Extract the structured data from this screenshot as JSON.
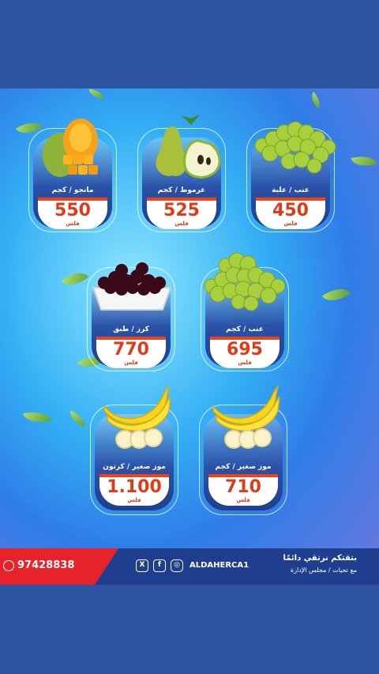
{
  "products": [
    {
      "id": "mango",
      "label": "مانجو / كجم",
      "price": "550",
      "unit": "فلس",
      "fruit_icon": "mango-icon"
    },
    {
      "id": "pear",
      "label": "عرموط / كجم",
      "price": "525",
      "unit": "فلس",
      "fruit_icon": "pear-icon"
    },
    {
      "id": "grapes-box",
      "label": "عنب / علبة",
      "price": "450",
      "unit": "فلس",
      "fruit_icon": "grapes-icon"
    },
    {
      "id": "cherry",
      "label": "كرز / طبق",
      "price": "770",
      "unit": "فلس",
      "fruit_icon": "cherry-tray-icon"
    },
    {
      "id": "grapes-kg",
      "label": "عنب / كجم",
      "price": "695",
      "unit": "فلس",
      "fruit_icon": "grapes-icon"
    },
    {
      "id": "banana-carton",
      "label": "موز صغير / كرتون",
      "price": "1.100",
      "unit": "فلس",
      "fruit_icon": "banana-icon"
    },
    {
      "id": "banana-kg",
      "label": "موز صغير / كجم",
      "price": "710",
      "unit": "فلس",
      "fruit_icon": "banana-icon"
    }
  ],
  "footer": {
    "phone": "97428838",
    "handle": "ALDAHERCA1",
    "slogan": "بثقتكم نرتقي دائمًا",
    "sub_slogan": "مع تحيات / مجلس الإدارة",
    "social_icons": [
      "x-icon",
      "facebook-icon",
      "instagram-icon",
      "whatsapp-icon"
    ]
  },
  "colors": {
    "brand_blue": "#1f3f8e",
    "price_red": "#e23a17",
    "footer_red": "#e8222a",
    "band_blue": "#2e54a0"
  }
}
